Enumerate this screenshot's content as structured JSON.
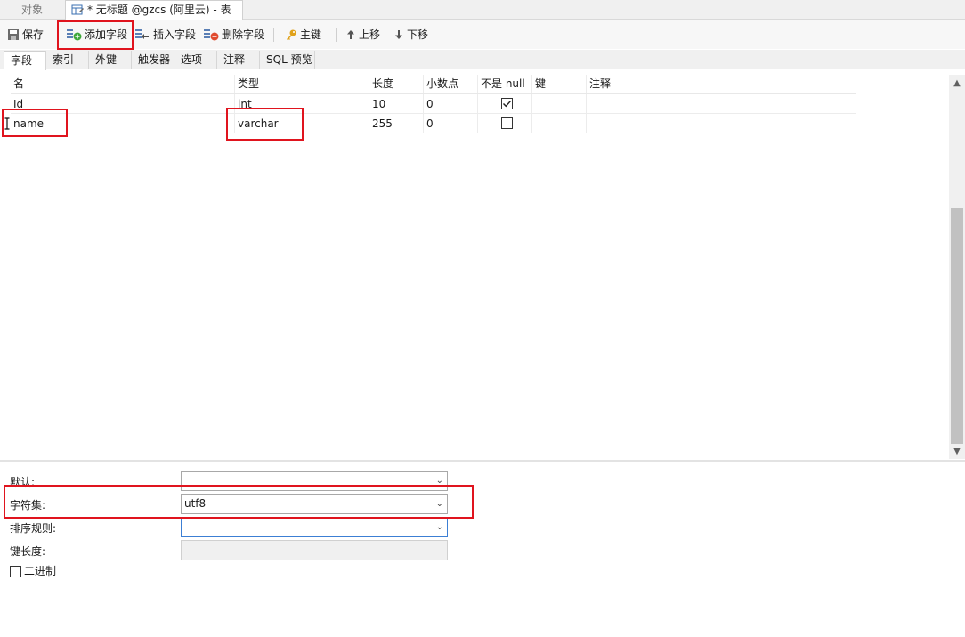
{
  "tabs": {
    "object_label": "对象",
    "doc_title": "* 无标题 @gzcs (阿里云) - 表"
  },
  "toolbar": {
    "save": "保存",
    "add_field": "添加字段",
    "insert_field": "插入字段",
    "delete_field": "删除字段",
    "primary_key": "主键",
    "move_up": "上移",
    "move_down": "下移"
  },
  "subtabs": [
    "字段",
    "索引",
    "外键",
    "触发器",
    "选项",
    "注释",
    "SQL 预览"
  ],
  "grid": {
    "columns": [
      "名",
      "类型",
      "长度",
      "小数点",
      "不是 null",
      "键",
      "注释"
    ],
    "rows": [
      {
        "name": "Id",
        "type": "int",
        "length": "10",
        "decimals": "0",
        "not_null": true,
        "key": "",
        "comment": ""
      },
      {
        "name": "name",
        "type": "varchar",
        "length": "255",
        "decimals": "0",
        "not_null": false,
        "key": "",
        "comment": ""
      }
    ]
  },
  "props": {
    "default_label": "默认:",
    "default_value": "",
    "charset_label": "字符集:",
    "charset_value": "utf8",
    "collation_label": "排序规则:",
    "collation_value": "",
    "keylen_label": "键长度:",
    "keylen_value": "",
    "binary_label": "二进制",
    "binary_checked": false
  },
  "colors": {
    "annotation_red": "#e0141e",
    "focus_blue": "#3c7fd4"
  }
}
